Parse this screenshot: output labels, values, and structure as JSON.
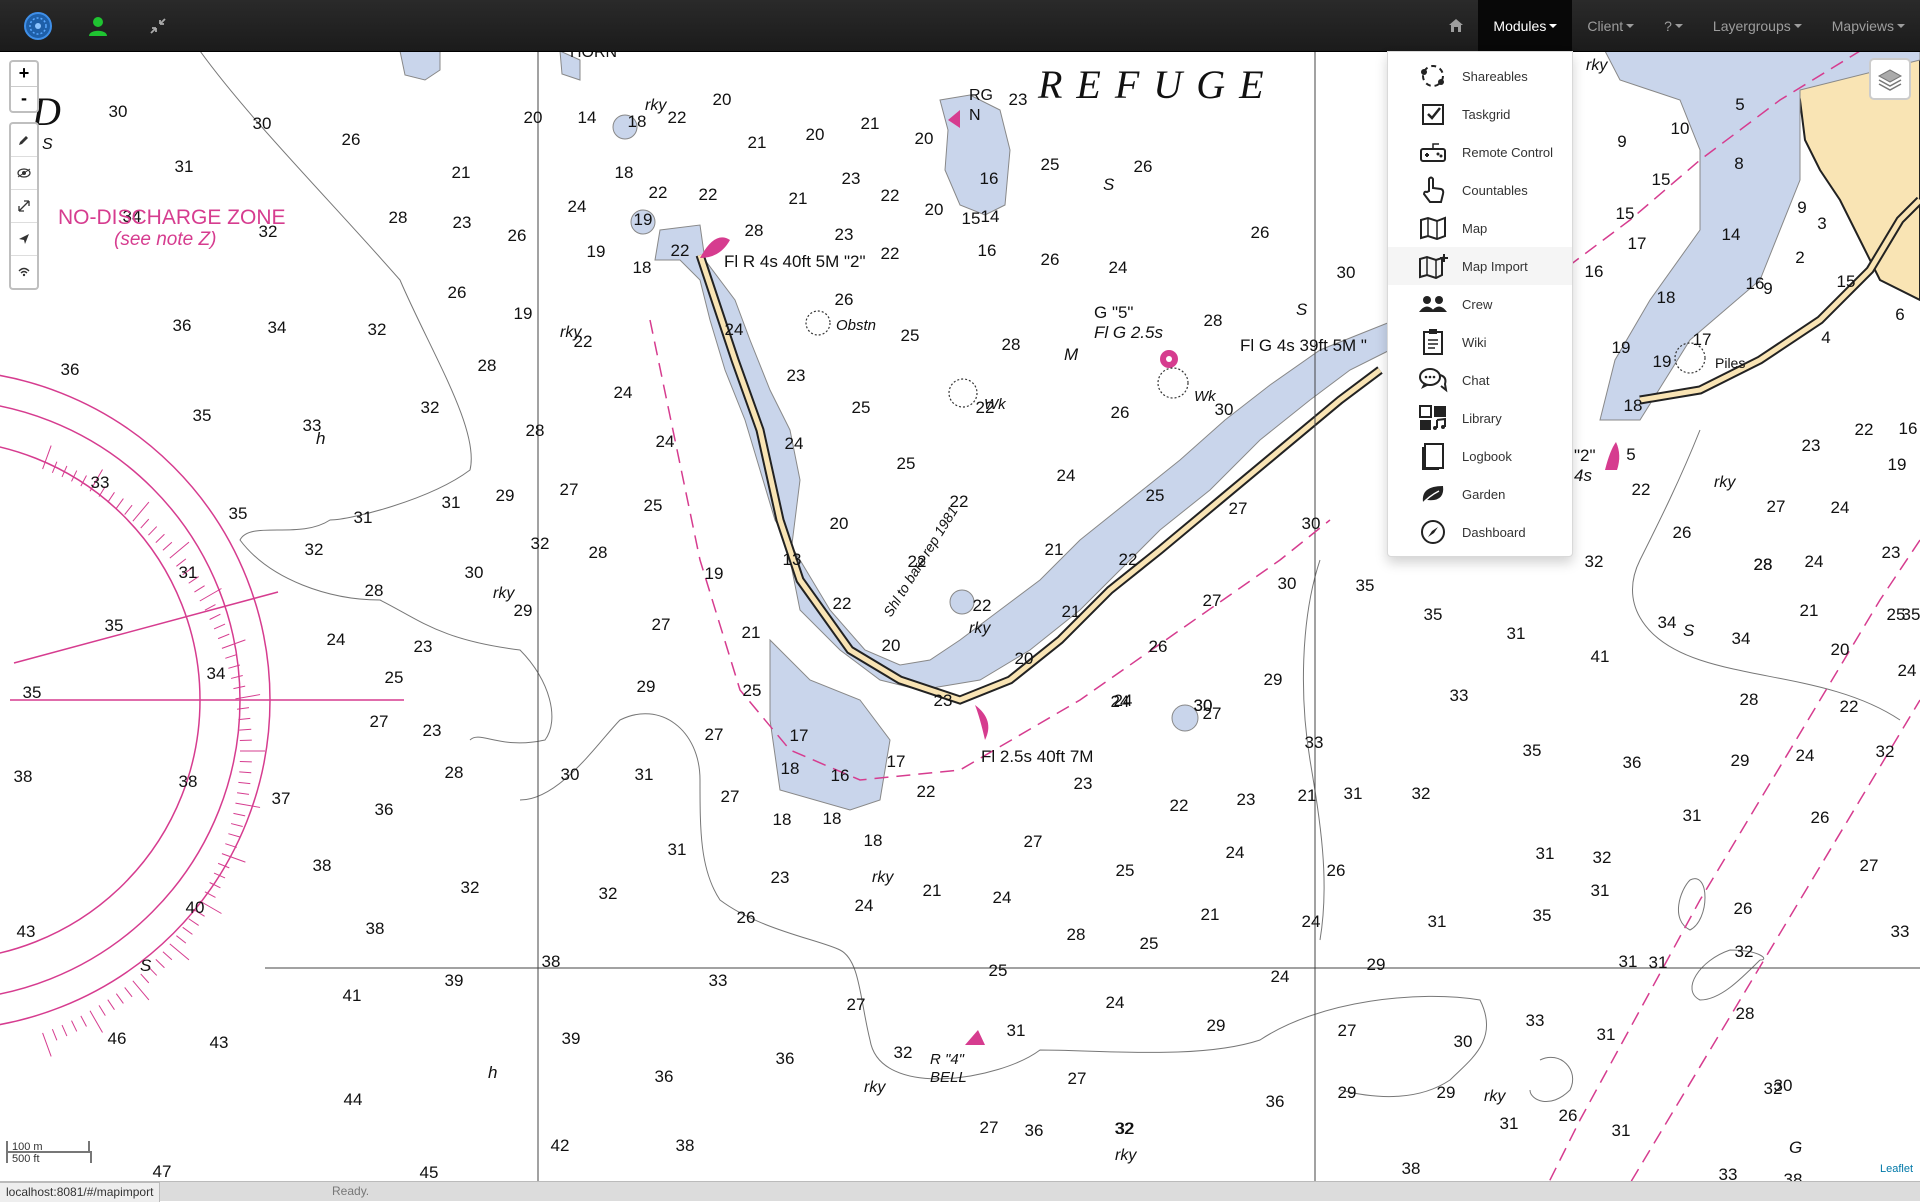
{
  "navbar": {
    "brand_icon": "compass-logo-icon",
    "user_icon": "user-icon",
    "collapse_icon": "compress-arrows-icon",
    "home_icon": "home-icon",
    "menus": [
      {
        "label": "Modules",
        "active": true
      },
      {
        "label": "Client",
        "active": false
      },
      {
        "label": "?",
        "active": false
      },
      {
        "label": "Layergroups",
        "active": false
      },
      {
        "label": "Mapviews",
        "active": false
      }
    ]
  },
  "modules_menu": {
    "items": [
      {
        "label": "Shareables",
        "icon": "share-dots-icon"
      },
      {
        "label": "Taskgrid",
        "icon": "checkbox-icon"
      },
      {
        "label": "Remote Control",
        "icon": "gamepad-icon"
      },
      {
        "label": "Countables",
        "icon": "hand-pointer-icon"
      },
      {
        "label": "Map",
        "icon": "map-icon"
      },
      {
        "label": "Map Import",
        "icon": "map-import-icon",
        "hover": true
      },
      {
        "label": "Crew",
        "icon": "group-icon"
      },
      {
        "label": "Wiki",
        "icon": "clipboard-icon"
      },
      {
        "label": "Chat",
        "icon": "chat-bubbles-icon"
      },
      {
        "label": "Library",
        "icon": "media-library-icon"
      },
      {
        "label": "Logbook",
        "icon": "book-icon"
      },
      {
        "label": "Garden",
        "icon": "leaf-icon"
      },
      {
        "label": "Dashboard",
        "icon": "compass-icon"
      }
    ]
  },
  "map": {
    "zoom_in": "+",
    "zoom_out": "-",
    "tools": [
      "pencil-icon",
      "eye-icon",
      "resize-icon",
      "send-icon",
      "wifi-icon"
    ],
    "layers_icon": "layers-icon",
    "scale_metric": "100 m",
    "scale_imperial": "500 ft",
    "attribution": "Leaflet",
    "chart_labels": {
      "refuge": "R E F U G E",
      "zone_title": "NO-DISCHARGE ZONE",
      "zone_note": "(see note Z)",
      "light_2": "Fl R 4s 40ft 5M \"2\"",
      "light_g": "Fl G 4s 39ft 5M \"",
      "light_end": "Fl 2.5s 40ft 7M",
      "buoy_5": "G \"5\"",
      "buoy_5_light": "Fl G 2.5s",
      "rg": "RG",
      "rg_n": "N",
      "obstn": "Obstn",
      "wk": "Wk",
      "rky": "rky",
      "piles": "Piles",
      "shl": "Shl to bare rep 1981",
      "r4": "R \"4\"",
      "bell": "BELL",
      "horn": "HORN",
      "d": "D",
      "buoy_2": "\"2\"",
      "buoy_2_light": "4s",
      "s": "S",
      "m": "M",
      "h": "h",
      "g": "G"
    },
    "soundings": [
      [
        "30",
        118,
        66
      ],
      [
        "30",
        262,
        78
      ],
      [
        "20",
        533,
        72
      ],
      [
        "14",
        587,
        72
      ],
      [
        "18",
        637,
        76
      ],
      [
        "22",
        677,
        72
      ],
      [
        "20",
        722,
        54
      ],
      [
        "21",
        757,
        97
      ],
      [
        "20",
        815,
        89
      ],
      [
        "21",
        870,
        78
      ],
      [
        "20",
        924,
        93
      ],
      [
        "23",
        1018,
        54
      ],
      [
        "26",
        351,
        94
      ],
      [
        "31",
        184,
        121
      ],
      [
        "21",
        461,
        127
      ],
      [
        "18",
        624,
        127
      ],
      [
        "22",
        658,
        147
      ],
      [
        "22",
        708,
        149
      ],
      [
        "23",
        851,
        133
      ],
      [
        "22",
        890,
        150
      ],
      [
        "21",
        798,
        153
      ],
      [
        "20",
        934,
        164
      ],
      [
        "15",
        971,
        173
      ],
      [
        "16",
        989,
        133
      ],
      [
        "14",
        990,
        171
      ],
      [
        "25",
        1050,
        119
      ],
      [
        "26",
        1143,
        121
      ],
      [
        "34",
        132,
        171
      ],
      [
        "32",
        268,
        186
      ],
      [
        "28",
        398,
        172
      ],
      [
        "23",
        462,
        177
      ],
      [
        "26",
        517,
        190
      ],
      [
        "24",
        577,
        161
      ],
      [
        "19",
        643,
        174
      ],
      [
        "19",
        596,
        206
      ],
      [
        "22",
        680,
        205
      ],
      [
        "18",
        642,
        222
      ],
      [
        "28",
        754,
        185
      ],
      [
        "23",
        844,
        189
      ],
      [
        "22",
        890,
        208
      ],
      [
        "16",
        987,
        205
      ],
      [
        "26",
        1050,
        214
      ],
      [
        "24",
        1118,
        222
      ],
      [
        "26",
        1260,
        187
      ],
      [
        "30",
        1346,
        227
      ],
      [
        "36",
        182,
        280
      ],
      [
        "34",
        277,
        282
      ],
      [
        "32",
        377,
        284
      ],
      [
        "26",
        457,
        247
      ],
      [
        "19",
        523,
        268
      ],
      [
        "22",
        583,
        296
      ],
      [
        "24",
        734,
        284
      ],
      [
        "26",
        844,
        254
      ],
      [
        "25",
        910,
        290
      ],
      [
        "28",
        1011,
        299
      ],
      [
        "28",
        1213,
        275
      ],
      [
        "36",
        70,
        324
      ],
      [
        "28",
        487,
        320
      ],
      [
        "24",
        623,
        347
      ],
      [
        "23",
        796,
        330
      ],
      [
        "25",
        861,
        362
      ],
      [
        "22",
        985,
        362
      ],
      [
        "26",
        1120,
        367
      ],
      [
        "30",
        1224,
        364
      ],
      [
        "35",
        202,
        370
      ],
      [
        "33",
        312,
        380
      ],
      [
        "32",
        430,
        362
      ],
      [
        "28",
        535,
        385
      ],
      [
        "24",
        665,
        396
      ],
      [
        "24",
        794,
        398
      ],
      [
        "24",
        1066,
        430
      ],
      [
        "25",
        1155,
        450
      ],
      [
        "27",
        1238,
        463
      ],
      [
        "33",
        100,
        437
      ],
      [
        "35",
        238,
        468
      ],
      [
        "31",
        363,
        472
      ],
      [
        "31",
        451,
        457
      ],
      [
        "29",
        505,
        450
      ],
      [
        "27",
        569,
        444
      ],
      [
        "25",
        653,
        460
      ],
      [
        "25",
        906,
        418
      ],
      [
        "20",
        839,
        478
      ],
      [
        "22",
        959,
        456
      ],
      [
        "21",
        1054,
        504
      ],
      [
        "22",
        1128,
        514
      ],
      [
        "30",
        1311,
        478
      ],
      [
        "32",
        314,
        504
      ],
      [
        "30",
        474,
        527
      ],
      [
        "28",
        598,
        507
      ],
      [
        "32",
        540,
        498
      ],
      [
        "19",
        714,
        528
      ],
      [
        "13",
        792,
        514
      ],
      [
        "22",
        917,
        516
      ],
      [
        "22",
        842,
        558
      ],
      [
        "22",
        982,
        560
      ],
      [
        "21",
        1071,
        566
      ],
      [
        "27",
        1212,
        555
      ],
      [
        "30",
        1287,
        538
      ],
      [
        "35",
        1365,
        540
      ],
      [
        "31",
        188,
        527
      ],
      [
        "28",
        374,
        545
      ],
      [
        "29",
        523,
        565
      ],
      [
        "24",
        336,
        594
      ],
      [
        "23",
        423,
        601
      ],
      [
        "25",
        394,
        632
      ],
      [
        "34",
        216,
        628
      ],
      [
        "35",
        114,
        580
      ],
      [
        "27",
        661,
        579
      ],
      [
        "21",
        751,
        587
      ],
      [
        "20",
        891,
        600
      ],
      [
        "20",
        1024,
        613
      ],
      [
        "24",
        1120,
        656
      ],
      [
        "26",
        1158,
        601
      ],
      [
        "27",
        1212,
        668
      ],
      [
        "29",
        1273,
        634
      ],
      [
        "30",
        1203,
        660
      ],
      [
        "35",
        1433,
        569
      ],
      [
        "31",
        1516,
        588
      ],
      [
        "41",
        1600,
        611
      ],
      [
        "34",
        1667,
        577
      ],
      [
        "34",
        1741,
        593
      ],
      [
        "20",
        1840,
        604
      ],
      [
        "24",
        1907,
        625
      ],
      [
        "35",
        32,
        647
      ],
      [
        "27",
        379,
        676
      ],
      [
        "23",
        432,
        685
      ],
      [
        "29",
        646,
        641
      ],
      [
        "25",
        752,
        645
      ],
      [
        "27",
        714,
        689
      ],
      [
        "17",
        799,
        690
      ],
      [
        "16",
        840,
        730
      ],
      [
        "17",
        896,
        716
      ],
      [
        "23",
        943,
        655
      ],
      [
        "24",
        1123,
        655
      ],
      [
        "30",
        1203,
        660
      ],
      [
        "33",
        1314,
        697
      ],
      [
        "35",
        1532,
        705
      ],
      [
        "36",
        1632,
        717
      ],
      [
        "29",
        1740,
        715
      ],
      [
        "24",
        1805,
        710
      ],
      [
        "22",
        1849,
        661
      ],
      [
        "28",
        1749,
        654
      ],
      [
        "33",
        1459,
        650
      ],
      [
        "38",
        23,
        731
      ],
      [
        "38",
        188,
        736
      ],
      [
        "37",
        281,
        753
      ],
      [
        "36",
        384,
        764
      ],
      [
        "28",
        454,
        727
      ],
      [
        "30",
        570,
        729
      ],
      [
        "31",
        644,
        729
      ],
      [
        "27",
        730,
        751
      ],
      [
        "18",
        790,
        723
      ],
      [
        "18",
        782,
        774
      ],
      [
        "18",
        832,
        773
      ],
      [
        "18",
        873,
        795
      ],
      [
        "22",
        926,
        746
      ],
      [
        "23",
        1083,
        738
      ],
      [
        "22",
        1179,
        760
      ],
      [
        "23",
        1246,
        754
      ],
      [
        "21",
        1307,
        750
      ],
      [
        "31",
        1353,
        748
      ],
      [
        "32",
        1421,
        748
      ],
      [
        "31",
        1692,
        770
      ],
      [
        "26",
        1820,
        772
      ],
      [
        "32",
        1885,
        706
      ],
      [
        "35",
        1911,
        569
      ],
      [
        "43",
        26,
        886
      ],
      [
        "40",
        195,
        862
      ],
      [
        "38",
        322,
        820
      ],
      [
        "32",
        470,
        842
      ],
      [
        "38",
        375,
        883
      ],
      [
        "32",
        608,
        848
      ],
      [
        "31",
        677,
        804
      ],
      [
        "23",
        780,
        832
      ],
      [
        "26",
        746,
        872
      ],
      [
        "24",
        864,
        860
      ],
      [
        "21",
        932,
        845
      ],
      [
        "24",
        1002,
        852
      ],
      [
        "27",
        1033,
        796
      ],
      [
        "25",
        1125,
        825
      ],
      [
        "28",
        1076,
        889
      ],
      [
        "25",
        1149,
        898
      ],
      [
        "21",
        1210,
        869
      ],
      [
        "24",
        1235,
        807
      ],
      [
        "26",
        1336,
        825
      ],
      [
        "24",
        1311,
        876
      ],
      [
        "31",
        1437,
        876
      ],
      [
        "35",
        1542,
        870
      ],
      [
        "32",
        1602,
        812
      ],
      [
        "31",
        1545,
        808
      ],
      [
        "31",
        1600,
        845
      ],
      [
        "26",
        1743,
        863
      ],
      [
        "27",
        1869,
        820
      ],
      [
        "33",
        1900,
        886
      ],
      [
        "32",
        1744,
        906
      ],
      [
        "31",
        1628,
        916
      ],
      [
        "31",
        1658,
        917
      ],
      [
        "41",
        352,
        950
      ],
      [
        "39",
        454,
        935
      ],
      [
        "38",
        551,
        916
      ],
      [
        "33",
        718,
        935
      ],
      [
        "27",
        856,
        959
      ],
      [
        "25",
        998,
        925
      ],
      [
        "24",
        1115,
        957
      ],
      [
        "29",
        1216,
        980
      ],
      [
        "24",
        1280,
        931
      ],
      [
        "29",
        1376,
        919
      ],
      [
        "27",
        1347,
        985
      ],
      [
        "30",
        1463,
        996
      ],
      [
        "33",
        1535,
        975
      ],
      [
        "31",
        1606,
        989
      ],
      [
        "28",
        1745,
        968
      ],
      [
        "46",
        117,
        993
      ],
      [
        "43",
        219,
        997
      ],
      [
        "44",
        353,
        1054
      ],
      [
        "39",
        571,
        993
      ],
      [
        "36",
        664,
        1031
      ],
      [
        "36",
        785,
        1013
      ],
      [
        "32",
        903,
        1007
      ],
      [
        "31",
        1016,
        985
      ],
      [
        "27",
        1077,
        1033
      ],
      [
        "32",
        1124,
        1083
      ],
      [
        "36",
        1275,
        1056
      ],
      [
        "29",
        1347,
        1047
      ],
      [
        "29",
        1446,
        1047
      ],
      [
        "31",
        1509,
        1078
      ],
      [
        "26",
        1568,
        1070
      ],
      [
        "31",
        1621,
        1085
      ],
      [
        "32",
        1773,
        1043
      ],
      [
        "30",
        1783,
        1040
      ],
      [
        "47",
        162,
        1126
      ],
      [
        "45",
        429,
        1127
      ],
      [
        "42",
        560,
        1100
      ],
      [
        "38",
        685,
        1100
      ],
      [
        "27",
        989,
        1082
      ],
      [
        "36",
        1034,
        1085
      ],
      [
        "32",
        1125,
        1083
      ],
      [
        "38",
        1411,
        1123
      ],
      [
        "33",
        1728,
        1129
      ],
      [
        "38",
        1793,
        1134
      ],
      [
        "35",
        806,
        1148
      ],
      [
        "40",
        946,
        1145
      ],
      [
        "44",
        1075,
        1173
      ],
      [
        "38",
        1186,
        1177
      ],
      [
        "38",
        1350,
        1177
      ],
      [
        "34",
        1473,
        1179
      ],
      [
        "33",
        1608,
        1184
      ],
      [
        "47",
        287,
        1170
      ],
      [
        "44",
        571,
        1177
      ],
      [
        "38",
        709,
        1193
      ],
      [
        "5",
        1740,
        59
      ],
      [
        "10",
        1680,
        83
      ],
      [
        "9",
        1622,
        96
      ],
      [
        "15",
        1661,
        134
      ],
      [
        "8",
        1739,
        118
      ],
      [
        "9",
        1802,
        162
      ],
      [
        "15",
        1625,
        168
      ],
      [
        "14",
        1731,
        189
      ],
      [
        "17",
        1637,
        198
      ],
      [
        "3",
        1822,
        178
      ],
      [
        "2",
        1800,
        212
      ],
      [
        "16",
        1594,
        226
      ],
      [
        "18",
        1666,
        252
      ],
      [
        "17",
        1702,
        294
      ],
      [
        "16",
        1755,
        238
      ],
      [
        "9",
        1768,
        243
      ],
      [
        "15",
        1846,
        236
      ],
      [
        "6",
        1900,
        269
      ],
      [
        "4",
        1826,
        292
      ],
      [
        "19",
        1621,
        302
      ],
      [
        "19",
        1662,
        316
      ],
      [
        "18",
        1633,
        360
      ],
      [
        "5",
        1631,
        409
      ],
      [
        "22",
        1641,
        444
      ],
      [
        "23",
        1811,
        400
      ],
      [
        "22",
        1864,
        384
      ],
      [
        "16",
        1908,
        383
      ],
      [
        "19",
        1897,
        419
      ],
      [
        "27",
        1776,
        461
      ],
      [
        "24",
        1840,
        462
      ],
      [
        "28",
        1763,
        519
      ],
      [
        "24",
        1814,
        516
      ],
      [
        "23",
        1891,
        507
      ],
      [
        "32",
        1594,
        516
      ],
      [
        "26",
        1682,
        487
      ],
      [
        "28",
        1763,
        519
      ],
      [
        "21",
        1809,
        565
      ],
      [
        "25",
        1896,
        569
      ]
    ]
  }
}
